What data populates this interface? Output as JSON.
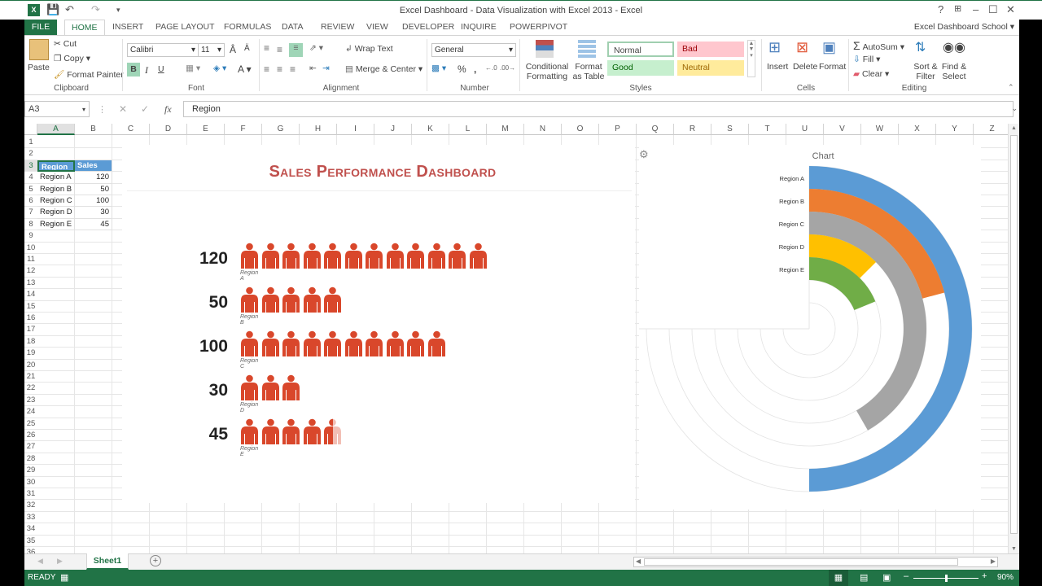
{
  "window": {
    "title": "Excel Dashboard - Data Visualization with Excel 2013 - Excel",
    "account": "Excel Dashboard School",
    "controls": [
      "?",
      "restore-ribbon",
      "minimize",
      "maximize",
      "close"
    ]
  },
  "tabs": [
    "FILE",
    "HOME",
    "INSERT",
    "PAGE LAYOUT",
    "FORMULAS",
    "DATA",
    "REVIEW",
    "VIEW",
    "DEVELOPER",
    "INQUIRE",
    "POWERPIVOT"
  ],
  "active_tab": "HOME",
  "ribbon": {
    "clipboard": {
      "label": "Clipboard",
      "paste": "Paste",
      "cut": "Cut",
      "copy": "Copy",
      "format_painter": "Format Painter"
    },
    "font": {
      "label": "Font",
      "font_name": "Calibri",
      "font_size": "11",
      "bold": "B",
      "italic": "I",
      "underline": "U"
    },
    "alignment": {
      "label": "Alignment",
      "wrap_text": "Wrap Text",
      "merge_center": "Merge & Center"
    },
    "number": {
      "label": "Number",
      "format": "General",
      "percent": "%",
      "comma": ","
    },
    "styles": {
      "label": "Styles",
      "conditional_formatting": "Conditional Formatting",
      "format_as_table": "Format as Table",
      "normal": "Normal",
      "bad": "Bad",
      "good": "Good",
      "neutral": "Neutral"
    },
    "cells": {
      "label": "Cells",
      "insert": "Insert",
      "delete": "Delete",
      "format": "Format"
    },
    "editing": {
      "label": "Editing",
      "autosum": "AutoSum",
      "fill": "Fill",
      "clear": "Clear",
      "sort_filter": "Sort & Filter",
      "find_select": "Find & Select"
    }
  },
  "formula_bar": {
    "name_box": "A3",
    "fx": "fx",
    "value": "Region"
  },
  "columns": [
    "A",
    "B",
    "C",
    "D",
    "E",
    "F",
    "G",
    "H",
    "I",
    "J",
    "K",
    "L",
    "M",
    "N",
    "O",
    "P",
    "Q",
    "R",
    "S",
    "T",
    "U",
    "V",
    "W",
    "X",
    "Y",
    "Z"
  ],
  "table": {
    "headers": [
      "Region",
      "Sales"
    ],
    "rows": [
      [
        "Region A",
        "120"
      ],
      [
        "Region B",
        "50"
      ],
      [
        "Region C",
        "100"
      ],
      [
        "Region D",
        "30"
      ],
      [
        "Region E",
        "45"
      ]
    ]
  },
  "dashboard": {
    "title": "Sales Performance Dashboard",
    "units_per_icon": 10,
    "icon_color": "#d9472b"
  },
  "chart_data": [
    {
      "type": "pictograph",
      "title": "Sales Performance Dashboard",
      "categories": [
        "Region A",
        "Region B",
        "Region C",
        "Region D",
        "Region E"
      ],
      "values": [
        120,
        50,
        100,
        30,
        45
      ],
      "units_per_icon": 10
    },
    {
      "type": "radial-bar",
      "title": "Radial Chart",
      "categories": [
        "Region A",
        "Region B",
        "Region C",
        "Region D",
        "Region E"
      ],
      "values": [
        120,
        50,
        100,
        30,
        45
      ],
      "max": 180,
      "colors": [
        "#5b9bd5",
        "#ed7d31",
        "#a5a5a5",
        "#ffc000",
        "#70ad47"
      ]
    }
  ],
  "sheet_tabs": [
    "Sheet1"
  ],
  "status": {
    "ready": "READY",
    "zoom": "90%",
    "zoom_fraction": 0.5
  }
}
